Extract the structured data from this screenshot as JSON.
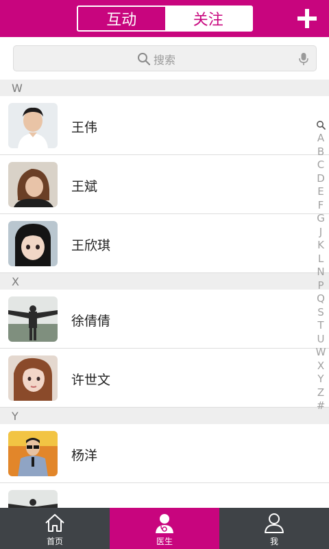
{
  "header": {
    "tabs": [
      {
        "label": "互动",
        "active": false
      },
      {
        "label": "关注",
        "active": true
      }
    ],
    "add_icon": "plus-icon",
    "accent_color": "#c8057e"
  },
  "search": {
    "placeholder": "搜索",
    "icons": [
      "search-icon",
      "microphone-icon"
    ]
  },
  "sections": [
    {
      "letter": "W",
      "contacts": [
        {
          "name": "王伟"
        },
        {
          "name": "王斌"
        },
        {
          "name": "王欣琪"
        }
      ]
    },
    {
      "letter": "X",
      "contacts": [
        {
          "name": "徐倩倩"
        },
        {
          "name": "许世文"
        }
      ]
    },
    {
      "letter": "Y",
      "contacts": [
        {
          "name": "杨洋"
        },
        {
          "name": ""
        }
      ]
    }
  ],
  "index_letters": [
    "A",
    "B",
    "C",
    "D",
    "E",
    "F",
    "G",
    "J",
    "K",
    "L",
    "N",
    "P",
    "Q",
    "S",
    "T",
    "U",
    "W",
    "X",
    "Y",
    "Z",
    "#"
  ],
  "bottom_nav": [
    {
      "label": "首页",
      "icon": "home-icon",
      "active": false
    },
    {
      "label": "医生",
      "icon": "doctor-icon",
      "active": true
    },
    {
      "label": "我",
      "icon": "person-icon",
      "active": false
    }
  ]
}
